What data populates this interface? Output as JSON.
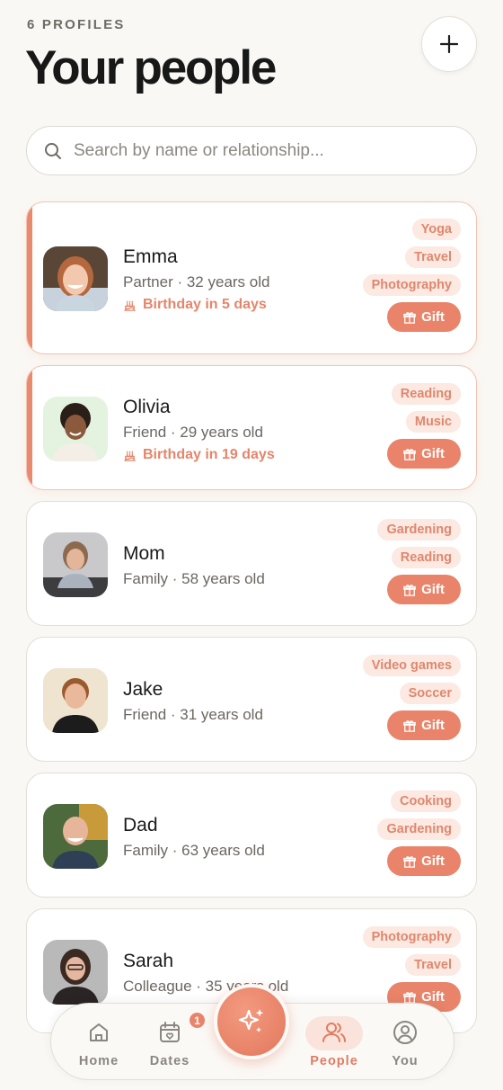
{
  "header": {
    "eyebrow": "6 PROFILES",
    "title": "Your people",
    "add_icon": "plus-icon"
  },
  "search": {
    "placeholder": "Search by name or relationship...",
    "icon": "search-icon"
  },
  "colors": {
    "accent": "#e9846a",
    "tag_bg": "#fbe9e2",
    "background": "#faf8f4"
  },
  "gift_label": "Gift",
  "profiles": [
    {
      "name": "Emma",
      "subtitle": "Partner · 32 years old",
      "birthday": "Birthday in 5 days",
      "tags": [
        "Yoga",
        "Travel",
        "Photography"
      ],
      "highlighted": true
    },
    {
      "name": "Olivia",
      "subtitle": "Friend · 29 years old",
      "birthday": "Birthday in 19 days",
      "tags": [
        "Reading",
        "Music"
      ],
      "highlighted": true
    },
    {
      "name": "Mom",
      "subtitle": "Family · 58 years old",
      "tags": [
        "Gardening",
        "Reading"
      ]
    },
    {
      "name": "Jake",
      "subtitle": "Friend · 31 years old",
      "tags": [
        "Video games",
        "Soccer"
      ]
    },
    {
      "name": "Dad",
      "subtitle": "Family · 63 years old",
      "tags": [
        "Cooking",
        "Gardening"
      ]
    },
    {
      "name": "Sarah",
      "subtitle": "Colleague · 35 years old",
      "tags": [
        "Photography",
        "Travel"
      ]
    }
  ],
  "nav": {
    "home": "Home",
    "dates": "Dates",
    "dates_badge": "1",
    "people": "People",
    "you": "You",
    "center_icon": "sparkles-icon"
  }
}
